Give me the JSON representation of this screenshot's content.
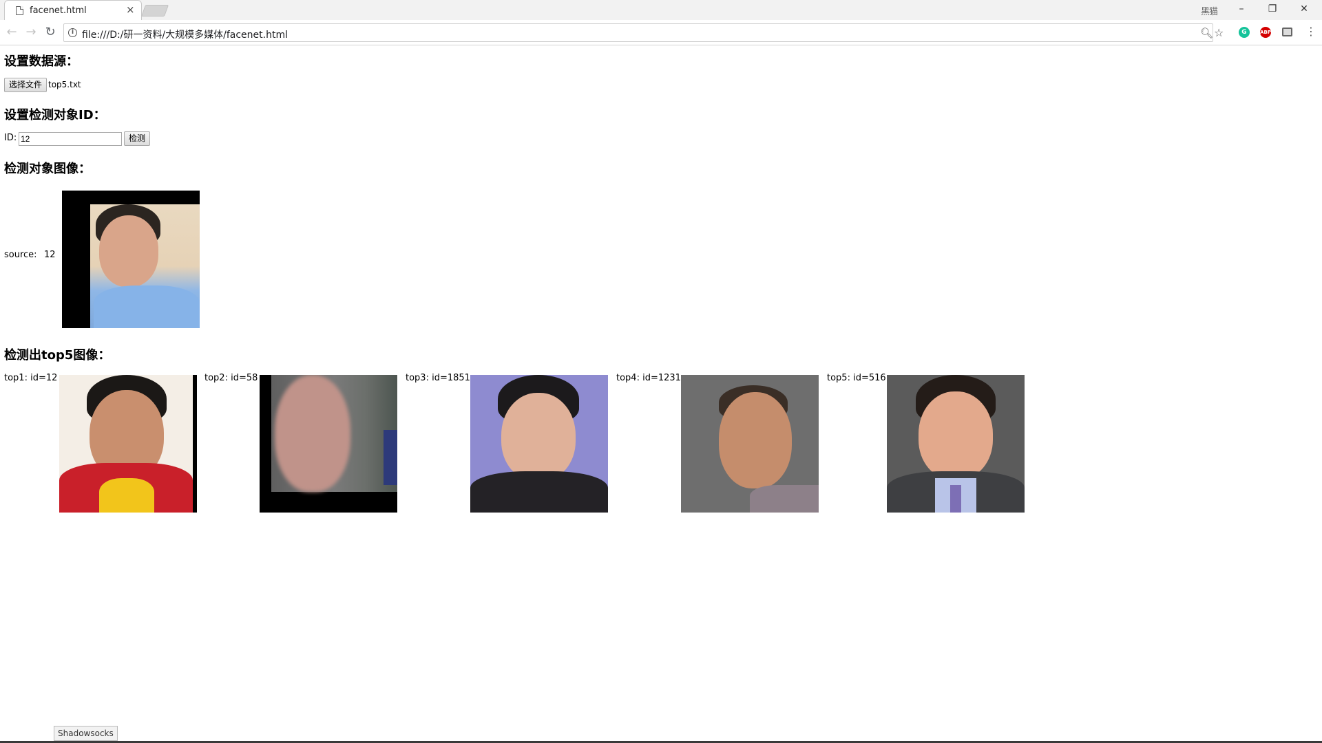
{
  "browser": {
    "tab_title": "facenet.html",
    "tab_close": "×",
    "user_label": "黑猫",
    "window_controls": {
      "minimize": "–",
      "restore": "❐",
      "close": "✕"
    },
    "nav": {
      "back": "←",
      "forward": "→",
      "reload": "↻"
    },
    "url": "file:///D:/研一资料/大规模多媒体/facenet.html",
    "extensions": [
      {
        "name": "grammarly-icon",
        "letter": "G",
        "color": "#15c39a"
      },
      {
        "name": "adblock-icon",
        "letter": "ABP",
        "color": "#d40000"
      }
    ],
    "menu": "⋮"
  },
  "page": {
    "section_datasource": {
      "title": "设置数据源：",
      "choose_button": "选择文件",
      "file_name": "top5.txt"
    },
    "section_target": {
      "title": "设置检测对象ID：",
      "id_label": "ID:",
      "id_value": "12",
      "detect_button": "检测"
    },
    "section_target_image": {
      "title": "检测对象图像：",
      "source_label": "source:",
      "source_value": "12"
    },
    "section_results": {
      "title": "检测出top5图像：",
      "results": [
        {
          "label": "top1: id=12"
        },
        {
          "label": "top2: id=58"
        },
        {
          "label": "top3: id=1851"
        },
        {
          "label": "top4: id=1231"
        },
        {
          "label": "top5: id=516"
        }
      ]
    }
  },
  "statusbar": {
    "text": "Shadowsocks"
  }
}
